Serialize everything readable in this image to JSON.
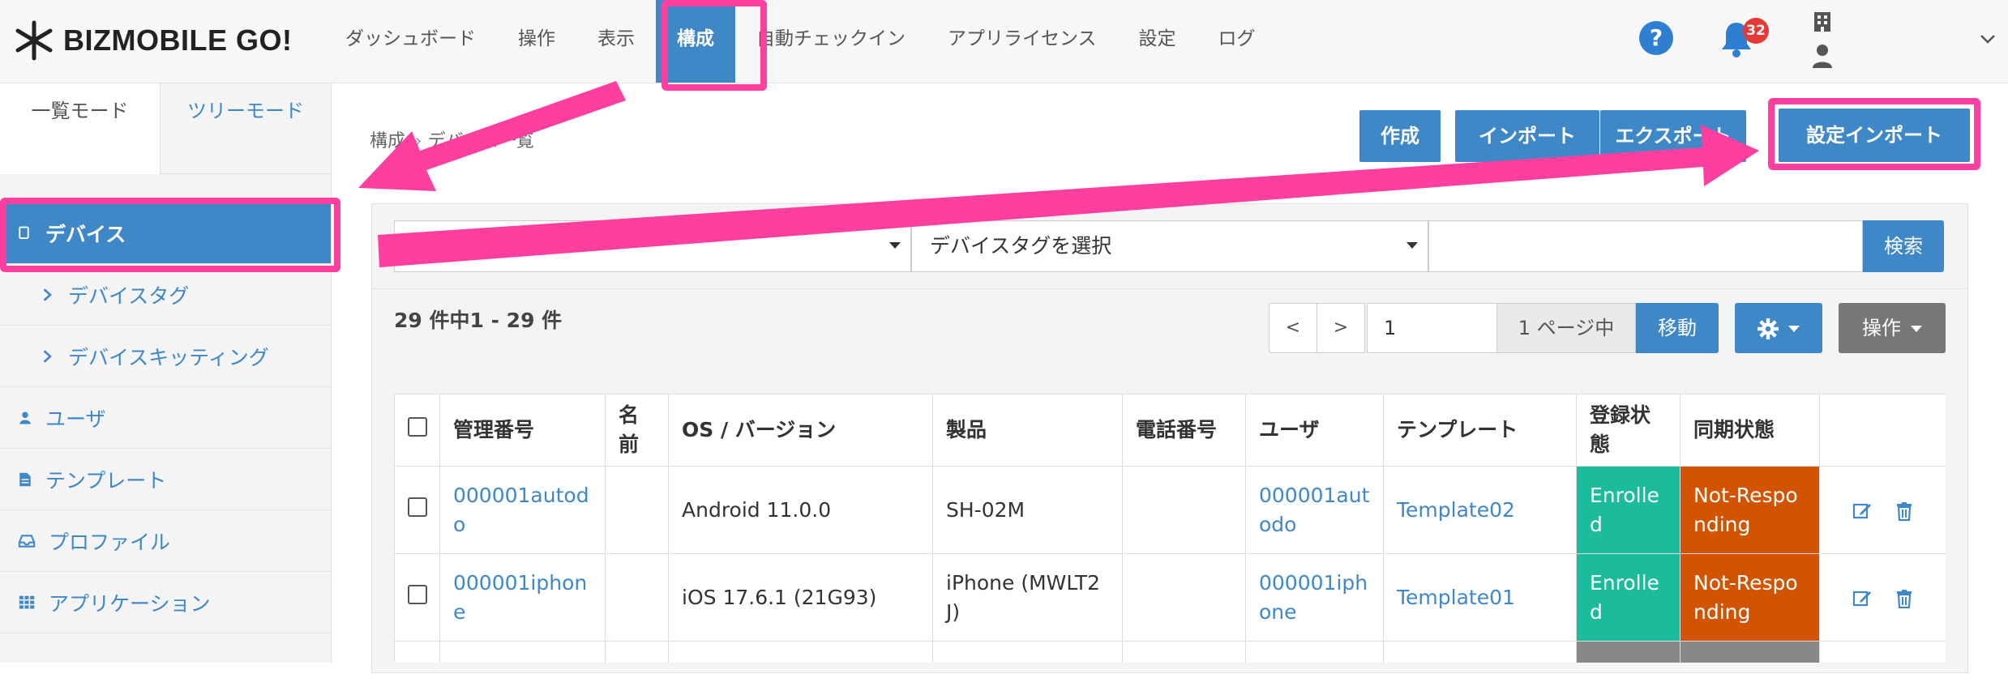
{
  "app": {
    "logo_text": "BIZMOBILE GO!",
    "notification_count": "32",
    "help_label": "?"
  },
  "nav": {
    "items": [
      {
        "label": "ダッシュボード"
      },
      {
        "label": "操作"
      },
      {
        "label": "表示"
      },
      {
        "label": "構成",
        "active": true
      },
      {
        "label": "自動チェックイン"
      },
      {
        "label": "アプリライセンス"
      },
      {
        "label": "設定"
      },
      {
        "label": "ログ"
      }
    ]
  },
  "sidebar": {
    "tab_list": "一覧モード",
    "tab_tree": "ツリーモード",
    "items": [
      {
        "label": "デバイス",
        "icon": "device-icon",
        "active": true
      },
      {
        "label": "デバイスタグ",
        "icon": "chevron-right-icon"
      },
      {
        "label": "デバイスキッティング",
        "icon": "chevron-right-icon"
      },
      {
        "label": "ユーザ",
        "icon": "user-icon"
      },
      {
        "label": "テンプレート",
        "icon": "document-icon"
      },
      {
        "label": "プロファイル",
        "icon": "inbox-icon"
      },
      {
        "label": "アプリケーション",
        "icon": "grid-icon"
      }
    ]
  },
  "breadcrumb": {
    "root": "構成",
    "sep": " » ",
    "current": "デバイス一覧"
  },
  "toolbar": {
    "create": "作成",
    "import": "インポート",
    "export": "エクスポート",
    "settings_import": "設定インポート"
  },
  "filter": {
    "select1_value": "",
    "select2_value": "デバイスタグを選択",
    "search_value": "",
    "search_button": "検索"
  },
  "pagination": {
    "count_text": "29 件中1 - 29 件",
    "prev": "<",
    "next": ">",
    "page": "1",
    "of_text": "1 ページ中",
    "move": "移動",
    "ops": "操作"
  },
  "table": {
    "headers": [
      "管理番号",
      "名前",
      "OS / バージョン",
      "製品",
      "電話番号",
      "ユーザ",
      "テンプレート",
      "登録状態",
      "同期状態"
    ],
    "rows": [
      {
        "id": "000001autodo",
        "name": "",
        "os": "Android 11.0.0",
        "product": "SH-02M",
        "phone": "",
        "user": "000001autodo",
        "template": "Template02",
        "enroll": "Enrolled",
        "sync": "Not-Responding"
      },
      {
        "id": "000001iphone",
        "name": "",
        "os": "iOS 17.6.1 (21G93)",
        "product": "iPhone (MWLT2J)",
        "phone": "",
        "user": "000001iphone",
        "template": "Template01",
        "enroll": "Enrolled",
        "sync": "Not-Responding"
      }
    ]
  },
  "colors": {
    "accent": "#3f88c8",
    "highlight": "#ff3fa0",
    "enrolled": "#1abc9c",
    "not_responding": "#d35400"
  }
}
